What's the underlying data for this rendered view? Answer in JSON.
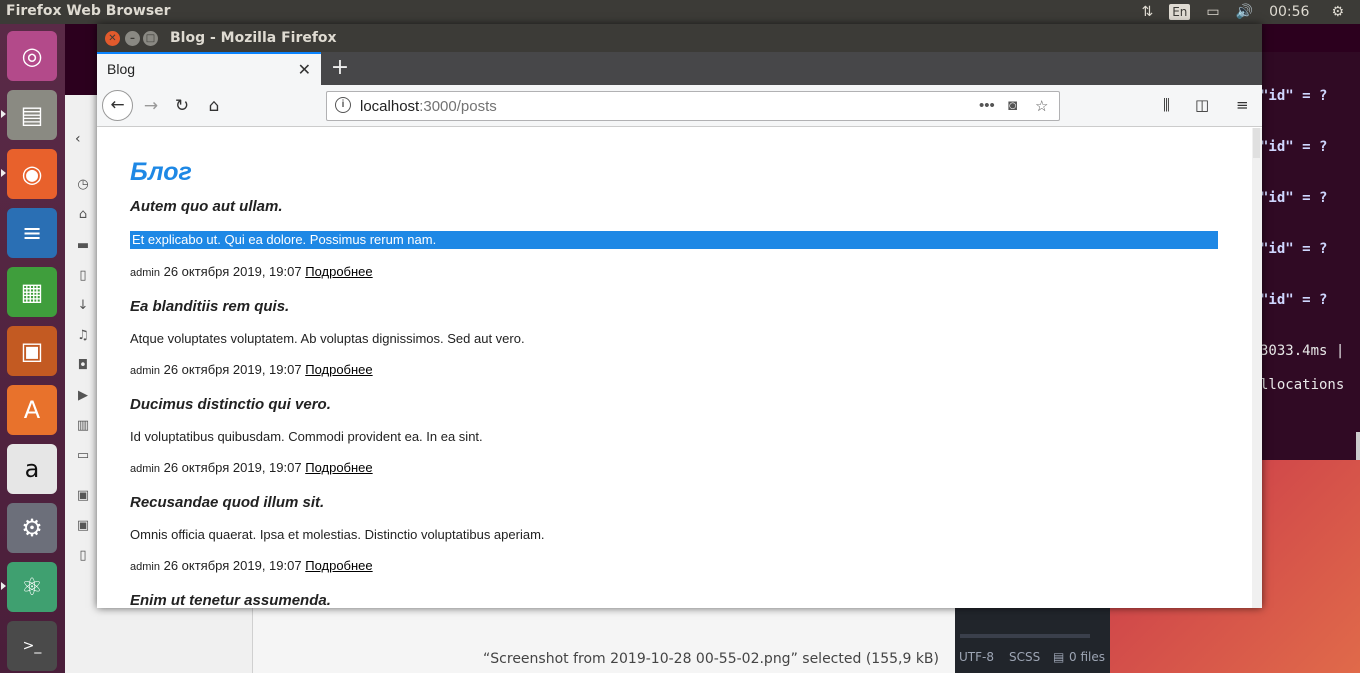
{
  "top_panel": {
    "app_title": "Firefox Web Browser",
    "lang": "En",
    "clock": "00:56"
  },
  "launcher": {
    "items": [
      "ubuntu-dash",
      "files",
      "firefox",
      "writer",
      "calc",
      "impress",
      "software-center",
      "amazon",
      "settings",
      "atom",
      "terminal"
    ]
  },
  "terminal": {
    "lines": [
      "\"id\" = ?",
      "\"id\" = ?",
      "\"id\" = ?",
      "\"id\" = ?",
      "\"id\" = ?",
      "3033.4ms |",
      "llocations"
    ]
  },
  "editor_bar": {
    "encoding": "UTF-8",
    "grammar": "SCSS",
    "files": "0 files"
  },
  "file_manager": {
    "status": "“Screenshot from 2019-10-28 00-55-02.png” selected  (155,9 kB)"
  },
  "firefox": {
    "window_title": "Blog - Mozilla Firefox",
    "tab_label": "Blog",
    "url_host": "localhost",
    "url_path": ":3000/posts"
  },
  "page": {
    "blog_title": "Блог",
    "posts": [
      {
        "title": "Autem quo aut ullam.",
        "body": "Et explicabo ut. Qui ea dolore. Possimus rerum nam.",
        "author": "admin",
        "date": "26 октября 2019, 19:07",
        "link": "Подробнее"
      },
      {
        "title": "Ea blanditiis rem quis.",
        "body": "Atque voluptates voluptatem. Ab voluptas dignissimos. Sed aut vero.",
        "author": "admin",
        "date": "26 октября 2019, 19:07",
        "link": "Подробнее"
      },
      {
        "title": "Ducimus distinctio qui vero.",
        "body": "Id voluptatibus quibusdam. Commodi provident ea. In ea sint.",
        "author": "admin",
        "date": "26 октября 2019, 19:07",
        "link": "Подробнее"
      },
      {
        "title": "Recusandae quod illum sit.",
        "body": "Omnis officia quaerat. Ipsa et molestias. Distinctio voluptatibus aperiam.",
        "author": "admin",
        "date": "26 октября 2019, 19:07",
        "link": "Подробнее"
      },
      {
        "title": "Enim ut tenetur assumenda."
      }
    ]
  }
}
